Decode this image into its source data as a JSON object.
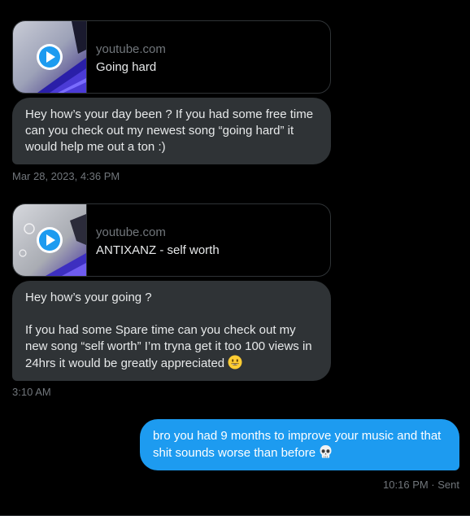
{
  "messages": [
    {
      "card": {
        "domain": "youtube.com",
        "title": "Going hard"
      },
      "text": "Hey how’s your day been ? If you had some free time can you check out my newest song “going hard” it would help me out a ton :)",
      "timestamp": "Mar 28, 2023, 4:36 PM"
    },
    {
      "card": {
        "domain": "youtube.com",
        "title": "ANTIXANZ - self worth"
      },
      "text_line1": "Hey how’s your going ?",
      "text_para2": "If you had some Spare time can you check out my new song “self worth” I’m tryna get it too 100 views in 24hrs it would be greatly appreciated",
      "emoji": "grinning-face-emoji",
      "timestamp": "3:10 AM"
    },
    {
      "text": "bro you had 9 months to improve your music and that shit sounds worse than before",
      "emoji": "skull-emoji",
      "timestamp": "10:16 PM · Sent"
    }
  ],
  "icons": {
    "play": "play-icon",
    "face": "grinning-face-emoji",
    "skull": "skull-emoji"
  },
  "colors": {
    "background": "#000000",
    "incoming_bubble": "#2f3336",
    "outgoing_bubble": "#1d9bf0",
    "muted_text": "#71767b"
  }
}
